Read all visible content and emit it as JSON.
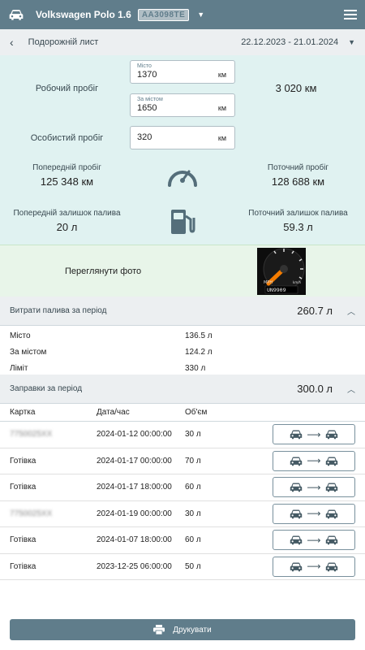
{
  "header": {
    "title": "Volkswagen Polo 1.6",
    "plate": "АА3098ТЕ",
    "icons": [
      "car-icon",
      "dropdown-icon",
      "menu-icon"
    ]
  },
  "subheader": {
    "title": "Подорожній лист",
    "period": "22.12.2023 - 21.01.2024"
  },
  "mileage": {
    "work_label": "Робочий пробіг",
    "city_field": {
      "label": "Місто",
      "value": "1370",
      "unit": "км"
    },
    "outside_field": {
      "label": "За містом",
      "value": "1650",
      "unit": "км"
    },
    "work_total": "3 020 км",
    "personal_label": "Особистий пробіг",
    "personal_field": {
      "value": "320",
      "unit": "км"
    },
    "prev_mileage_label": "Попередній пробіг",
    "prev_mileage_value": "125 348 км",
    "curr_mileage_label": "Поточний пробіг",
    "curr_mileage_value": "128 688 км",
    "prev_fuel_label": "Попередній залишок палива",
    "prev_fuel_value": "20 л",
    "curr_fuel_label": "Поточний залишок палива",
    "curr_fuel_value": "59.3 л"
  },
  "photo": {
    "label": "Переглянути фото",
    "thumb_mph": "MPH",
    "thumb_kmh": "km/h",
    "thumb_odo": "UN9909"
  },
  "fuel_consumption": {
    "title": "Витрати палива за період",
    "total": "260.7 л",
    "rows": [
      {
        "label": "Місто",
        "value": "136.5 л"
      },
      {
        "label": "За містом",
        "value": "124.2 л"
      },
      {
        "label": "Ліміт",
        "value": "330 л"
      }
    ]
  },
  "refuels": {
    "title": "Заправки за період",
    "total": "300.0 л",
    "columns": [
      "Картка",
      "Дата/час",
      "Об'єм"
    ],
    "rows": [
      {
        "card": "7750025ХХ",
        "datetime": "2024-01-12 00:00:00",
        "volume": "30 л",
        "card_blurred": true
      },
      {
        "card": "Готівка",
        "datetime": "2024-01-17 00:00:00",
        "volume": "70 л",
        "card_blurred": false
      },
      {
        "card": "Готівка",
        "datetime": "2024-01-17 18:00:00",
        "volume": "60 л",
        "card_blurred": false
      },
      {
        "card": "7750025ХХ",
        "datetime": "2024-01-19 00:00:00",
        "volume": "30 л",
        "card_blurred": true
      },
      {
        "card": "Готівка",
        "datetime": "2024-01-07 18:00:00",
        "volume": "60 л",
        "card_blurred": false
      },
      {
        "card": "Готівка",
        "datetime": "2023-12-25 06:00:00",
        "volume": "50 л",
        "card_blurred": false
      }
    ]
  },
  "print": {
    "label": "Друкувати"
  },
  "colors": {
    "primary": "#607d8b",
    "panel": "#e0f2f1",
    "photo_bg": "#e8f5e9",
    "section_bg": "#eceff1"
  }
}
